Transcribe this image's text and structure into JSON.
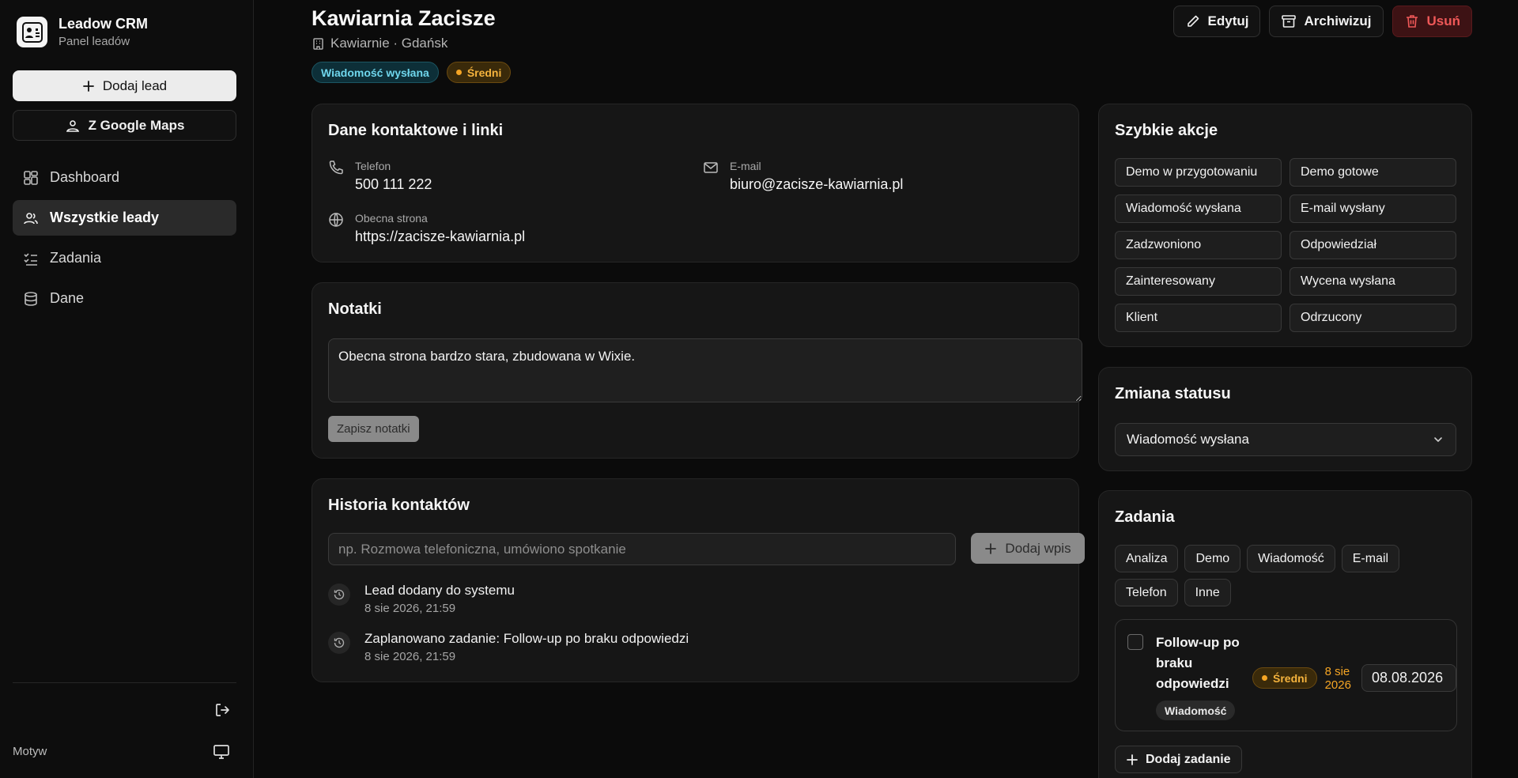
{
  "app": {
    "title": "Leadow CRM",
    "subtitle": "Panel leadów"
  },
  "sidebar": {
    "add_lead": "Dodaj lead",
    "google_maps": "Z Google Maps",
    "nav": [
      {
        "label": "Dashboard",
        "icon": "dashboard-icon"
      },
      {
        "label": "Wszystkie leady",
        "icon": "users-icon",
        "active": true
      },
      {
        "label": "Zadania",
        "icon": "tasks-icon"
      },
      {
        "label": "Dane",
        "icon": "database-icon"
      }
    ],
    "theme_label": "Motyw"
  },
  "lead": {
    "name": "Kawiarnia Zacisze",
    "category_city": "Kawiarnie · Gdańsk",
    "status_badge": "Wiadomość wysłana",
    "priority_badge": "Średni"
  },
  "actions": {
    "edit": "Edytuj",
    "archive": "Archiwizuj",
    "delete": "Usuń"
  },
  "contact": {
    "title": "Dane kontaktowe i linki",
    "phone_label": "Telefon",
    "phone": "500 111 222",
    "email_label": "E-mail",
    "email": "biuro@zacisze-kawiarnia.pl",
    "website_label": "Obecna strona",
    "website": "https://zacisze-kawiarnia.pl"
  },
  "notes": {
    "title": "Notatki",
    "value": "Obecna strona bardzo stara, zbudowana w Wixie.",
    "save": "Zapisz notatki"
  },
  "history": {
    "title": "Historia kontaktów",
    "placeholder": "np. Rozmowa telefoniczna, umówiono spotkanie",
    "add": "Dodaj wpis",
    "entries": [
      {
        "text": "Lead dodany do systemu",
        "time": "8 sie 2026, 21:59"
      },
      {
        "text": "Zaplanowano zadanie: Follow-up po braku odpowiedzi",
        "time": "8 sie 2026, 21:59"
      }
    ]
  },
  "quick_actions": {
    "title": "Szybkie akcje",
    "buttons": [
      "Demo w przygotowaniu",
      "Demo gotowe",
      "Wiadomość wysłana",
      "E-mail wysłany",
      "Zadzwoniono",
      "Odpowiedział",
      "Zainteresowany",
      "Wycena wysłana",
      "Klient",
      "Odrzucony"
    ]
  },
  "status_change": {
    "title": "Zmiana statusu",
    "selected": "Wiadomość wysłana"
  },
  "tasks": {
    "title": "Zadania",
    "types": [
      "Analiza",
      "Demo",
      "Wiadomość",
      "E-mail",
      "Telefon",
      "Inne"
    ],
    "items": [
      {
        "title": "Follow-up po braku odpowiedzi",
        "priority": "Średni",
        "due": "8 sie 2026",
        "date_value": "08.08.2026",
        "type": "Wiadomość",
        "done": false
      }
    ],
    "add": "Dodaj zadanie"
  },
  "colors": {
    "accent_amber": "#f5a524",
    "accent_cyan": "#6fd6ec",
    "danger": "#ef5858",
    "background": "#0b0b0b",
    "card": "#161616"
  }
}
